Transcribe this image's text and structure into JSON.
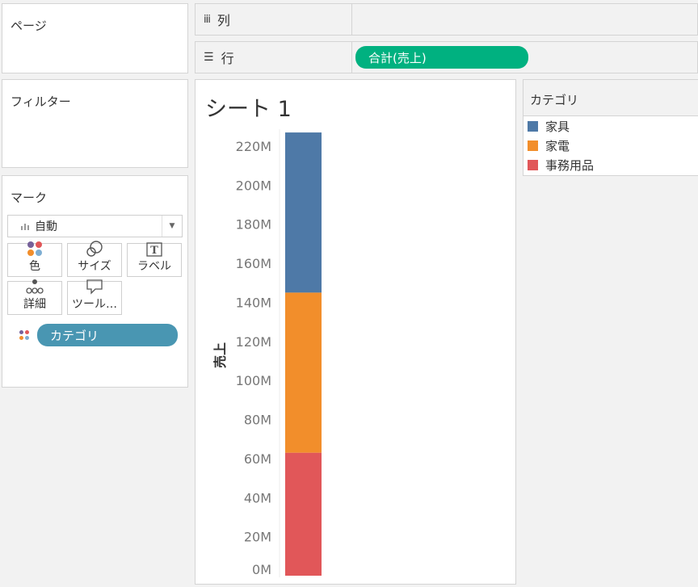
{
  "pages": {
    "title": "ページ"
  },
  "filters": {
    "title": "フィルター"
  },
  "marks": {
    "title": "マーク",
    "mark_type": "自動",
    "buttons": [
      {
        "label": "色",
        "icon": "color-dots-icon"
      },
      {
        "label": "サイズ",
        "icon": "size-circles-icon"
      },
      {
        "label": "ラベル",
        "icon": "text-label-icon"
      },
      {
        "label": "詳細",
        "icon": "detail-dots-icon"
      },
      {
        "label": "ツール…",
        "icon": "tooltip-bubble-icon"
      }
    ],
    "color_field": "カテゴリ"
  },
  "shelves": {
    "columns_label": "列",
    "rows_label": "行",
    "rows_pill": "合計(売上)"
  },
  "sheet": {
    "title": "シート 1"
  },
  "legend": {
    "title": "カテゴリ",
    "items": [
      {
        "label": "家具",
        "color": "#4e79a7"
      },
      {
        "label": "家電",
        "color": "#f28e2b"
      },
      {
        "label": "事務用品",
        "color": "#e15759"
      }
    ]
  },
  "colors": {
    "rows_pill": "#00b180",
    "dimension_pill": "#4996b2"
  },
  "chart_data": {
    "type": "bar",
    "stacked": true,
    "categories": [
      ""
    ],
    "series": [
      {
        "name": "事務用品",
        "values": [
          63
        ],
        "color": "#e15759"
      },
      {
        "name": "家電",
        "values": [
          82
        ],
        "color": "#f28e2b"
      },
      {
        "name": "家具",
        "values": [
          82
        ],
        "color": "#4e79a7"
      }
    ],
    "ylabel": "売上",
    "ylim": [
      0,
      240
    ],
    "yticks": [
      "0M",
      "20M",
      "40M",
      "60M",
      "80M",
      "100M",
      "120M",
      "140M",
      "160M",
      "180M",
      "200M",
      "220M"
    ],
    "grid": false,
    "legend": "right-panel"
  }
}
